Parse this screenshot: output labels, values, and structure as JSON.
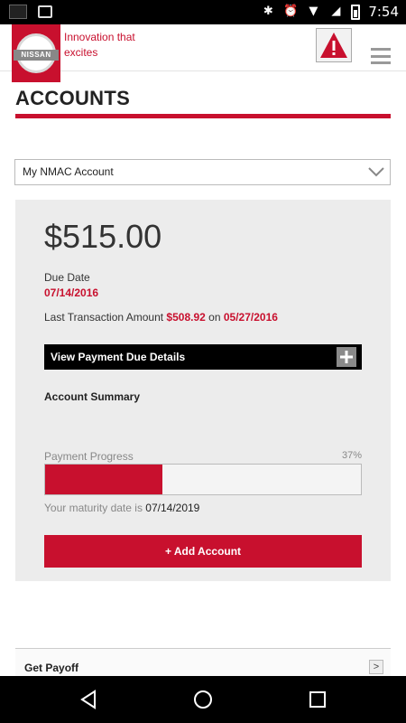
{
  "status_bar": {
    "time": "7:54"
  },
  "header": {
    "brand": "NISSAN",
    "tagline": "Innovation that excites",
    "colors": {
      "accent": "#c8102e"
    }
  },
  "page": {
    "title": "ACCOUNTS"
  },
  "account_selector": {
    "selected": "My NMAC Account"
  },
  "summary_card": {
    "amount_due": "$515.00",
    "due_date_label": "Due Date",
    "due_date": "07/14/2016",
    "last_txn_label": "Last Transaction Amount",
    "last_txn_amount": "$508.92",
    "last_txn_on": "on",
    "last_txn_date": "05/27/2016",
    "details_label": "View Payment Due Details",
    "account_summary_label": "Account Summary",
    "progress_label": "Payment Progress",
    "progress_percent_text": "37%",
    "progress_fraction": 0.37,
    "maturity_label": "Your maturity date is",
    "maturity_date": "07/14/2019",
    "add_account_label": "+ Add Account"
  },
  "payoff": {
    "label": "Get Payoff",
    "arrow": ">"
  }
}
